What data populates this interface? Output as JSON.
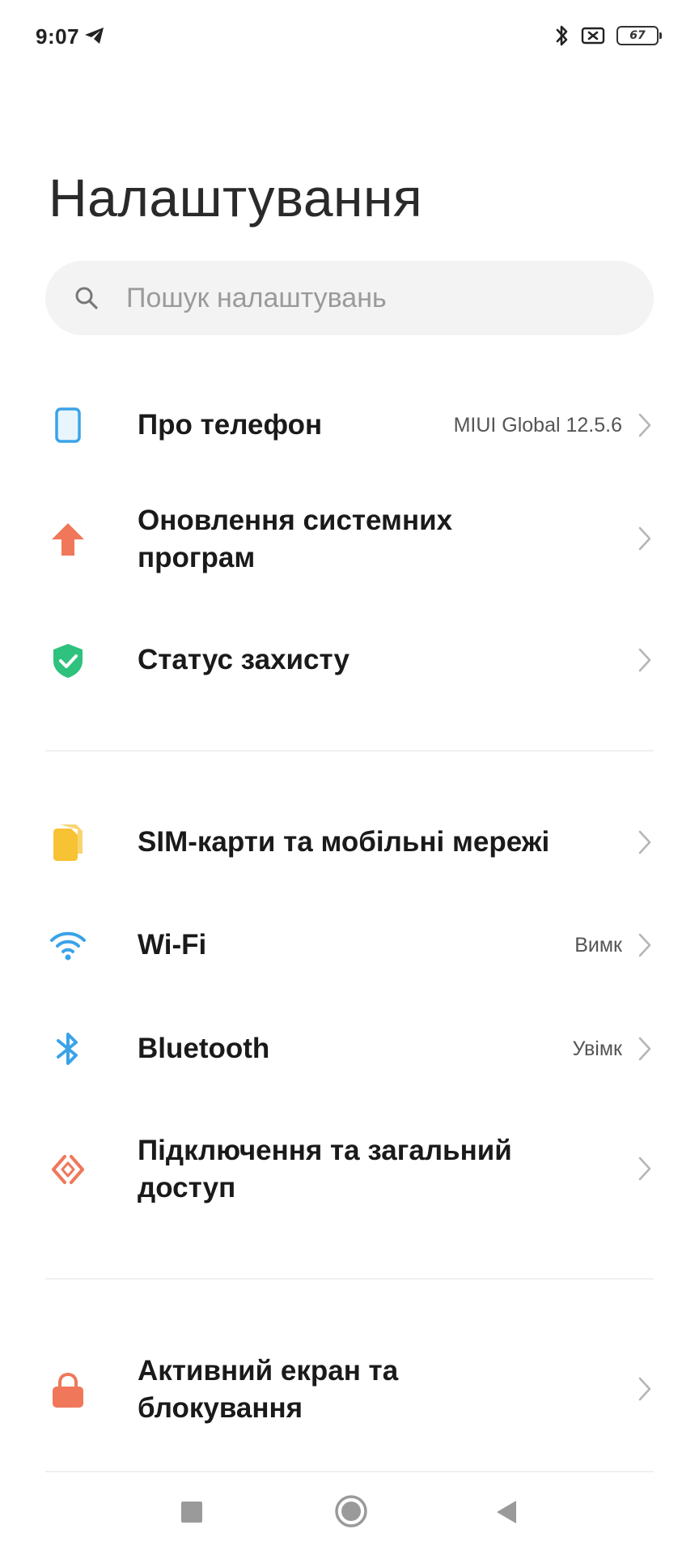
{
  "status_bar": {
    "time": "9:07",
    "battery": "67"
  },
  "title": "Налаштування",
  "search": {
    "placeholder": "Пошук налаштувань"
  },
  "items": [
    {
      "label": "Про телефон",
      "value": "MIUI Global 12.5.6",
      "icon": "phone-icon",
      "color": "#3aa3e8"
    },
    {
      "label": "Оновлення системних програм",
      "value": "",
      "icon": "arrow-up-icon",
      "color": "#f0775a"
    },
    {
      "label": "Статус захисту",
      "value": "",
      "icon": "shield-icon",
      "color": "#2ec27e"
    },
    {
      "label": "SIM-карти та мобільні мережі",
      "value": "",
      "icon": "sim-card-icon",
      "color": "#f7c234"
    },
    {
      "label": "Wi-Fi",
      "value": "Вимк",
      "icon": "wifi-icon",
      "color": "#3aa3e8"
    },
    {
      "label": "Bluetooth",
      "value": "Увімк",
      "icon": "bluetooth-icon",
      "color": "#3aa3e8"
    },
    {
      "label": "Підключення та загальний доступ",
      "value": "",
      "icon": "share-icon",
      "color": "#f0775a"
    },
    {
      "label": "Активний екран та блокування",
      "value": "",
      "icon": "lock-icon",
      "color": "#f0775a"
    }
  ]
}
